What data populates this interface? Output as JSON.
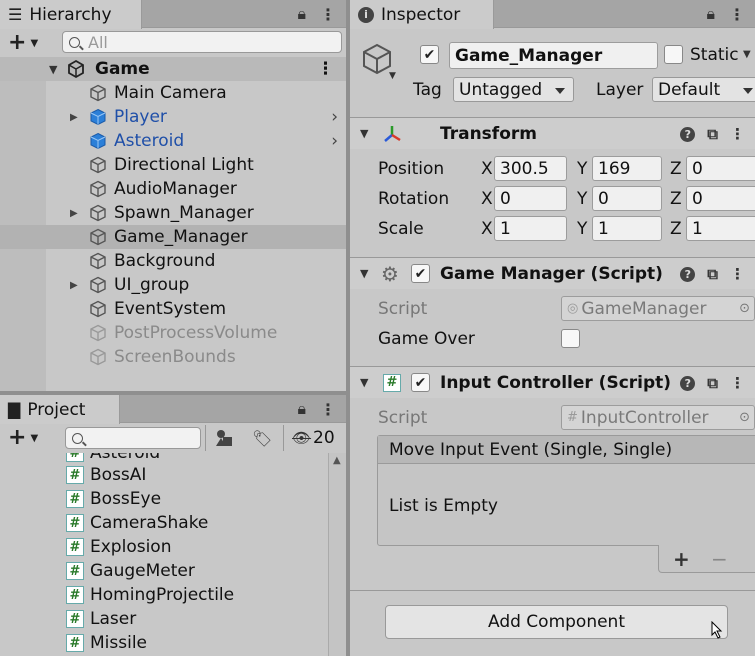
{
  "hierarchy": {
    "tab_label": "Hierarchy",
    "search_placeholder": "All",
    "scene": "Game",
    "items": [
      {
        "label": "Main Camera"
      },
      {
        "label": "Player"
      },
      {
        "label": "Asteroid"
      },
      {
        "label": "Directional Light"
      },
      {
        "label": "AudioManager"
      },
      {
        "label": "Spawn_Manager"
      },
      {
        "label": "Game_Manager"
      },
      {
        "label": "Background"
      },
      {
        "label": "UI_group"
      },
      {
        "label": "EventSystem"
      },
      {
        "label": "PostProcessVolume"
      },
      {
        "label": "ScreenBounds"
      }
    ]
  },
  "project": {
    "tab_label": "Project",
    "hidden_count": "20",
    "partial_item": "Asteroid",
    "items": [
      "BossAI",
      "BossEye",
      "CameraShake",
      "Explosion",
      "GaugeMeter",
      "HomingProjectile",
      "Laser",
      "Missile"
    ]
  },
  "inspector": {
    "tab_label": "Inspector",
    "object_name": "Game_Manager",
    "static_label": "Static",
    "tag_label": "Tag",
    "tag_value": "Untagged",
    "layer_label": "Layer",
    "layer_value": "Default",
    "transform": {
      "title": "Transform",
      "position_label": "Position",
      "rotation_label": "Rotation",
      "scale_label": "Scale",
      "x": "X",
      "y": "Y",
      "z": "Z",
      "position": {
        "x": "300.5",
        "y": "169",
        "z": "0"
      },
      "rotation": {
        "x": "0",
        "y": "0",
        "z": "0"
      },
      "scale": {
        "x": "1",
        "y": "1",
        "z": "1"
      }
    },
    "game_manager": {
      "title": "Game Manager (Script)",
      "script_label": "Script",
      "script_value": "GameManager",
      "game_over_label": "Game Over"
    },
    "input_controller": {
      "title": "Input Controller (Script)",
      "script_label": "Script",
      "script_value": "InputController",
      "event_title": "Move Input Event (Single, Single)",
      "empty_text": "List is Empty",
      "add": "+",
      "remove": "−"
    },
    "add_component": "Add Component"
  }
}
